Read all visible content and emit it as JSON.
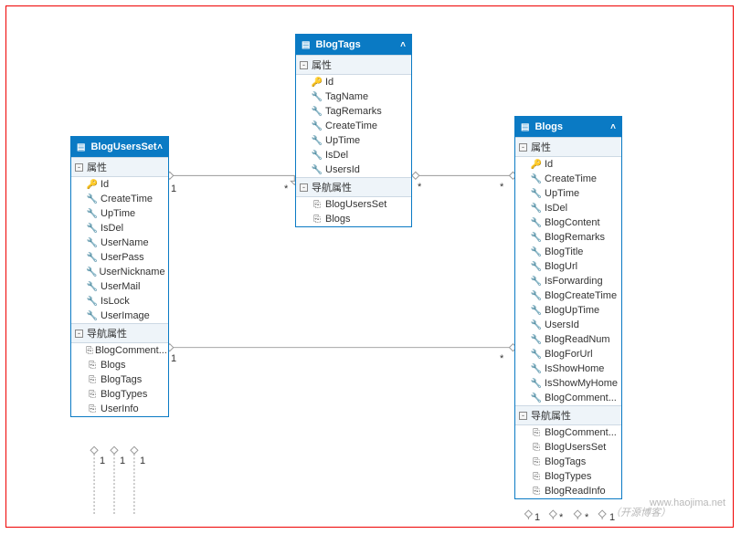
{
  "labels": {
    "properties": "属性",
    "navProps": "导航属性"
  },
  "card": {
    "one": "1",
    "many": "*"
  },
  "footer": {
    "text": "（开源博客）",
    "url": "www.haojima.net"
  },
  "entities": [
    {
      "name": "BlogUsersSet",
      "props": [
        "Id",
        "CreateTime",
        "UpTime",
        "IsDel",
        "UserName",
        "UserPass",
        "UserNickname",
        "UserMail",
        "IsLock",
        "UserImage"
      ],
      "nav": [
        "BlogComment...",
        "Blogs",
        "BlogTags",
        "BlogTypes",
        "UserInfo"
      ]
    },
    {
      "name": "BlogTags",
      "props": [
        "Id",
        "TagName",
        "TagRemarks",
        "CreateTime",
        "UpTime",
        "IsDel",
        "UsersId"
      ],
      "nav": [
        "BlogUsersSet",
        "Blogs"
      ]
    },
    {
      "name": "Blogs",
      "props": [
        "Id",
        "CreateTime",
        "UpTime",
        "IsDel",
        "BlogContent",
        "BlogRemarks",
        "BlogTitle",
        "BlogUrl",
        "IsForwarding",
        "BlogCreateTime",
        "BlogUpTime",
        "UsersId",
        "BlogReadNum",
        "BlogForUrl",
        "IsShowHome",
        "IsShowMyHome",
        "BlogComment..."
      ],
      "nav": [
        "BlogComment...",
        "BlogUsersSet",
        "BlogTags",
        "BlogTypes",
        "BlogReadInfo"
      ]
    }
  ]
}
